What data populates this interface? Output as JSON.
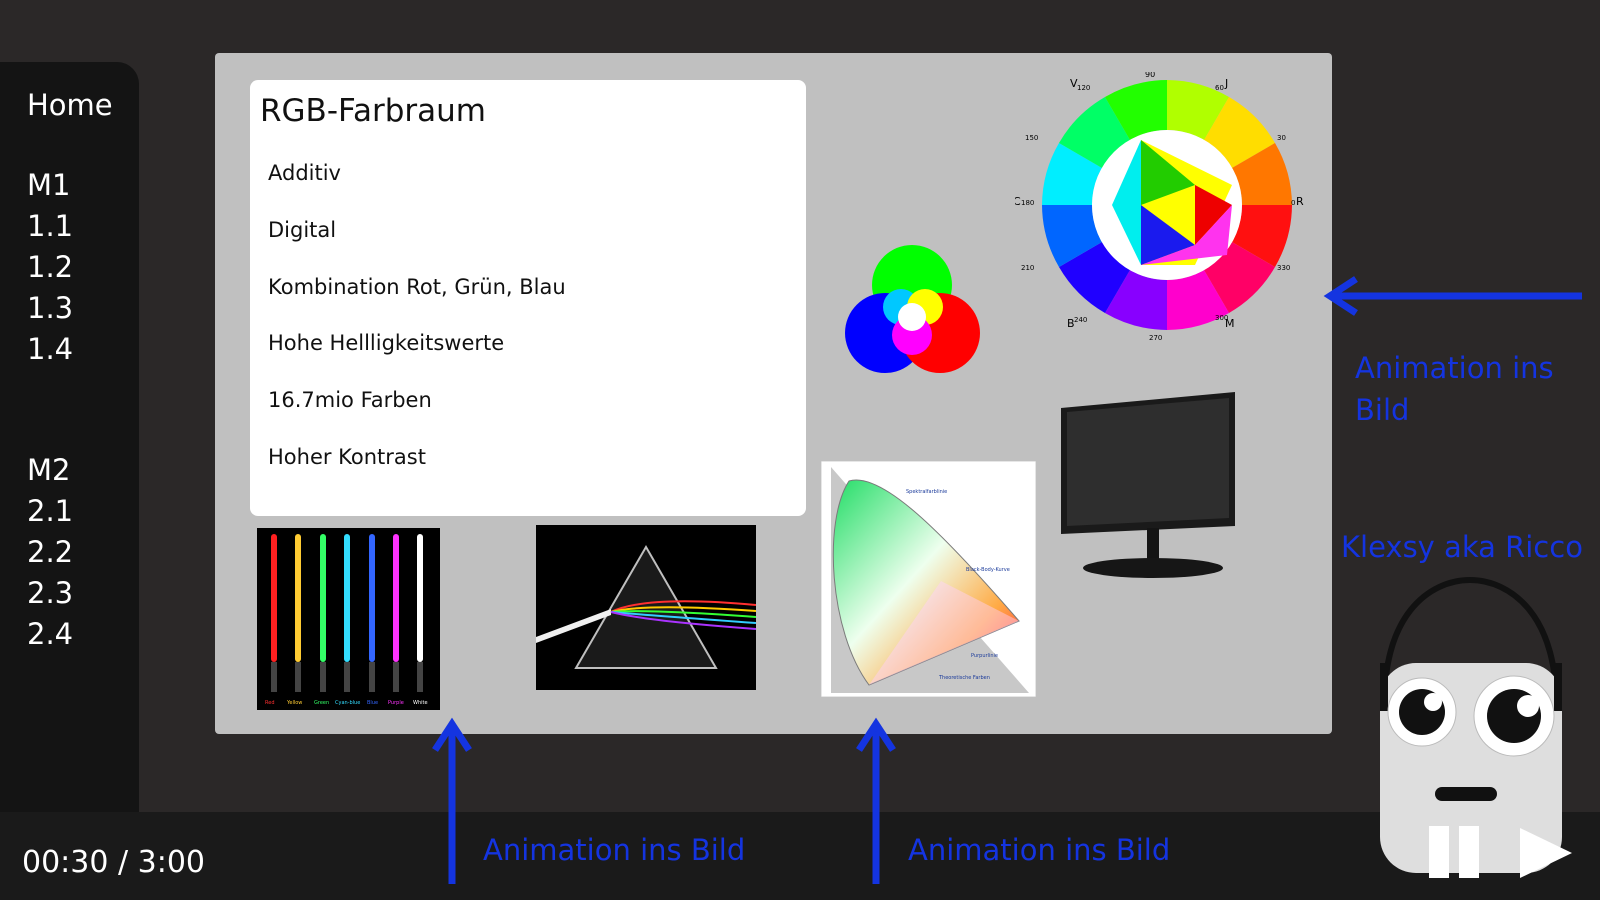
{
  "sidebar": {
    "home": "Home",
    "items": [
      "M1",
      "1.1",
      "1.2",
      "1.3",
      "1.4",
      "M2",
      "2.1",
      "2.2",
      "2.3",
      "2.4"
    ]
  },
  "player": {
    "time": "00:30 / 3:00"
  },
  "slide": {
    "title": "RGB-Farbraum",
    "bullets": [
      "Additiv",
      "Digital",
      "Kombination Rot, Grün, Blau",
      "Hohe Hellligkeitswerte",
      "16.7mio Farben",
      "Hoher Kontrast"
    ],
    "lightsaber_labels": [
      "Red",
      "Yellow",
      "Green",
      "Cyan-blue",
      "Blue",
      "Purple",
      "White"
    ],
    "cie_labels": [
      "Spektralfarblinie",
      "Black-Body-Kurve",
      "Purpurlinie",
      "Theoretische Farben"
    ],
    "wheel_labels": [
      "90",
      "V",
      "120",
      "J",
      "60",
      "150",
      "30",
      "C",
      "180",
      "0",
      "R",
      "210",
      "330",
      "B",
      "240",
      "300",
      "M",
      "270"
    ]
  },
  "annotations": {
    "right": "Animation ins Bild",
    "bottom_left": "Animation ins Bild",
    "bottom_mid": "Animation ins Bild",
    "character": "Klexsy aka Ricco"
  },
  "colors": {
    "accent": "#1434e0",
    "slide_bg": "#c0c0c0",
    "sidebar_bg": "#141414"
  }
}
